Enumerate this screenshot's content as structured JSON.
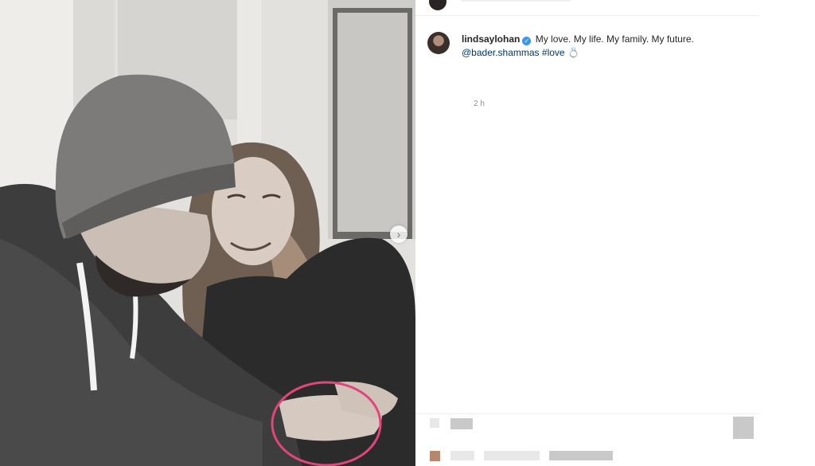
{
  "post": {
    "username": "lindsaylohan",
    "verified_icon": "verified-badge-icon",
    "caption_text": "My love. My life. My family. My future.",
    "mention": "@bader.shammas",
    "hashtag": "#love",
    "emoji": "💍",
    "timestamp": "2 h"
  },
  "photo": {
    "carousel_next_icon": "chevron-right-icon",
    "carousel_next_glyph": "›",
    "highlight_ring_color": "#e0457b"
  },
  "colors": {
    "link": "#00376b",
    "verified": "#3897f0",
    "muted": "#8e8e8e"
  }
}
